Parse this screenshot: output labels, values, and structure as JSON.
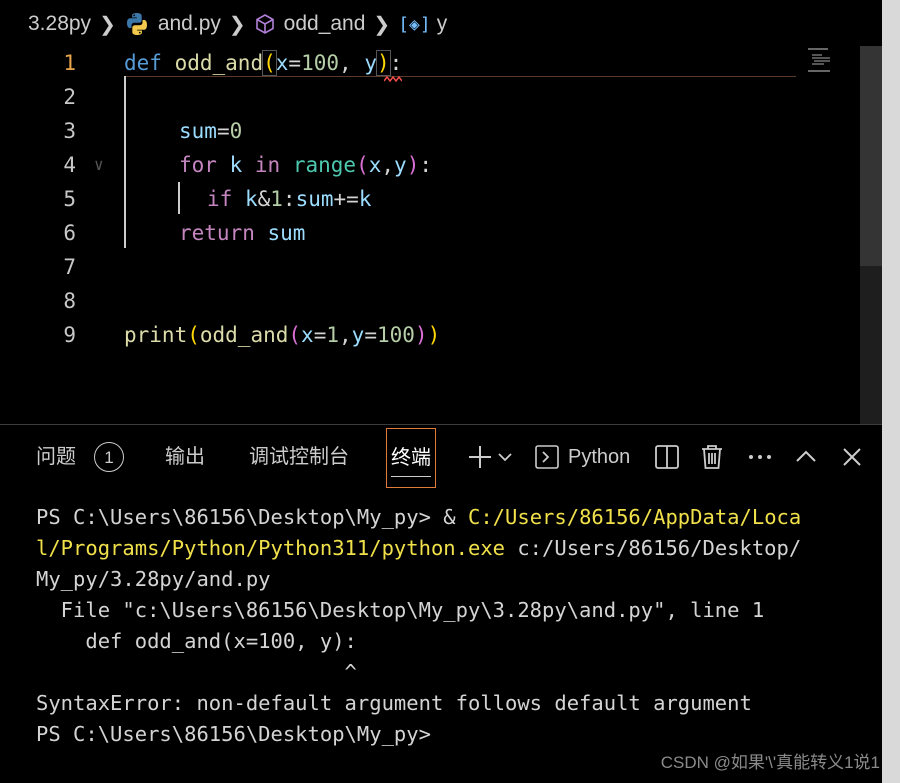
{
  "breadcrumb": {
    "folder": "3.28py",
    "file": "and.py",
    "function": "odd_and",
    "variable": "y"
  },
  "editor": {
    "line_numbers": [
      "1",
      "2",
      "3",
      "4",
      "5",
      "6",
      "7",
      "8",
      "9"
    ],
    "lines": {
      "l1": {
        "kw": "def",
        "fn": "odd_and",
        "p1": "x",
        "eq1": "=",
        "n1": "100",
        "comma": ", ",
        "p2": "y",
        "colon": ":"
      },
      "l3": {
        "var": "sum",
        "eq": "=",
        "num": "0"
      },
      "l4": {
        "kw": "for",
        "var": "k",
        "kw_in": "in",
        "fn": "range",
        "p1": "x",
        "comma": ",",
        "p2": "y",
        "colon": ":"
      },
      "l5": {
        "kw": "if",
        "expr1": "k",
        "amp": "&",
        "num": "1",
        "colon": ":",
        "expr2": "sum",
        "op": "+=",
        "expr3": "k"
      },
      "l6": {
        "kw": "return",
        "var": "sum"
      },
      "l9": {
        "fn": "print",
        "fn2": "odd_and",
        "p1": "x",
        "eq1": "=",
        "n1": "1",
        "comma": ",",
        "p2": "y",
        "eq2": "=",
        "n2": "100"
      }
    }
  },
  "panel": {
    "tabs": {
      "problems": "问题",
      "problems_count": "1",
      "output": "输出",
      "debug_console": "调试控制台",
      "terminal": "终端"
    },
    "terminal_profile": "Python"
  },
  "terminal": {
    "l1a": "PS C:\\Users\\86156\\Desktop\\My_py> & ",
    "l1b": "C:/Users/86156/AppData/Loca",
    "l2a": "l/Programs/Python/Python311/python.exe",
    "l2b": " c:/Users/86156/Desktop/",
    "l3": "My_py/3.28py/and.py",
    "l4": "  File \"c:\\Users\\86156\\Desktop\\My_py\\3.28py\\and.py\", line 1",
    "l5": "    def odd_and(x=100, y):",
    "l6": "                         ^",
    "l7": "SyntaxError: non-default argument follows default argument",
    "l8": "PS C:\\Users\\86156\\Desktop\\My_py>"
  },
  "watermark": "CSDN @如果'\\'真能转义1说1",
  "colors": {
    "keyword": "#569cd6",
    "control": "#c586c0",
    "function": "#dcdcaa",
    "parameter": "#9cdcfe",
    "number": "#b5cea8",
    "path_highlight": "#f0e04a",
    "active_tab_border": "#e07b39"
  }
}
